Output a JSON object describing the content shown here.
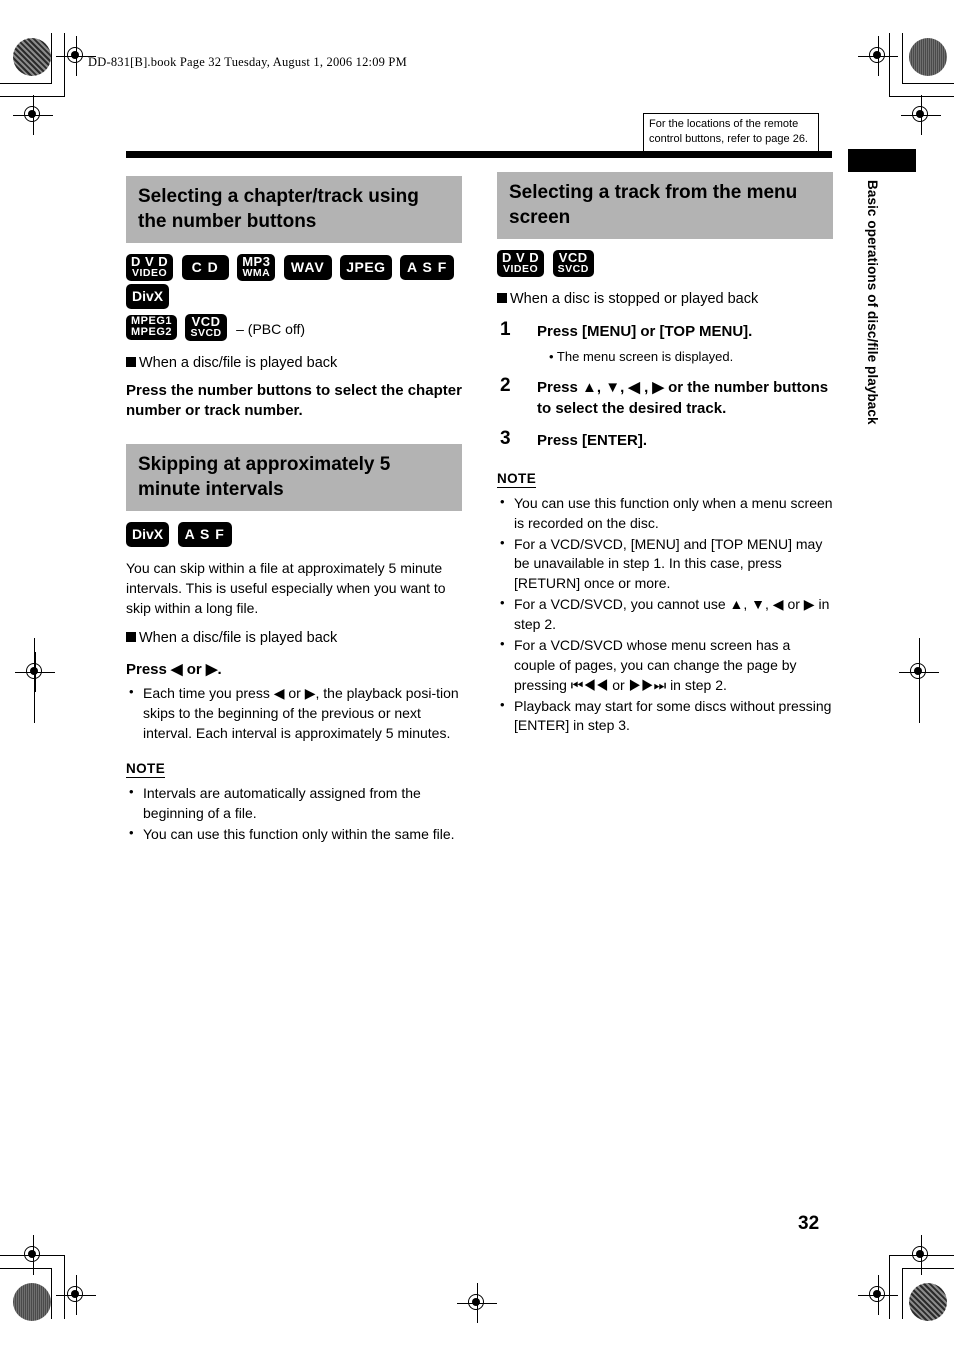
{
  "document": {
    "file_header": "DD-831[B].book  Page 32  Tuesday, August 1, 2006  12:09 PM",
    "page_number": "32",
    "side_tab_label": "Basic operations of disc/file playback",
    "reference_box": "For the locations of the remote control buttons, refer to page 26."
  },
  "colors": {
    "heading_bar": "#b3b3b3",
    "badge_background": "#000000",
    "rule": "#000000",
    "page_background": "#ffffff"
  },
  "left_column": {
    "section1": {
      "heading": "Selecting a chapter/track using the number buttons",
      "badges_row1": [
        {
          "type": "two-line",
          "line1": "D V D",
          "line2": "VIDEO"
        },
        {
          "type": "one-line",
          "text": "C D"
        },
        {
          "type": "two-line",
          "line1": "MP3",
          "line2": "WMA"
        },
        {
          "type": "one-line",
          "text": "WAV"
        },
        {
          "type": "one-line",
          "text": "JPEG"
        },
        {
          "type": "one-line",
          "text": "A S F"
        },
        {
          "type": "one-line",
          "text": "DivX"
        }
      ],
      "badges_row2": [
        {
          "type": "two-line",
          "line1": "MPEG1",
          "line2": "MPEG2"
        },
        {
          "type": "two-line",
          "line1": "VCD",
          "line2": "SVCD"
        }
      ],
      "badges_row2_suffix": "– (PBC off)",
      "condition": "When a disc/file is played back",
      "instruction": "Press the number buttons to select the chapter number or track number."
    },
    "section2": {
      "heading": "Skipping at approximately 5 minute intervals",
      "badges": [
        {
          "type": "one-line",
          "text": "DivX"
        },
        {
          "type": "one-line",
          "text": "A S F"
        }
      ],
      "body": "You can skip within a file at approximately 5 minute intervals. This is useful especially when you want to skip within a long file.",
      "condition": "When a disc/file is played back",
      "press_line": "Press ◀ or ▶.",
      "bullets": [
        "Each time you press ◀ or ▶, the playback posi-tion skips to the beginning of the previous or next interval. Each interval is approximately 5 minutes."
      ],
      "note_title": "NOTE",
      "note_bullets": [
        "Intervals are automatically assigned from the beginning of a file.",
        "You can use this function only within the same file."
      ]
    }
  },
  "right_column": {
    "section1": {
      "heading": "Selecting a track from the menu screen",
      "badges": [
        {
          "type": "two-line",
          "line1": "D V D",
          "line2": "VIDEO"
        },
        {
          "type": "two-line",
          "line1": "VCD",
          "line2": "SVCD"
        }
      ],
      "condition": "When a disc is stopped or played back",
      "steps": [
        {
          "number": "1",
          "text": "Press [MENU] or [TOP MENU].",
          "sub": "• The menu screen is displayed."
        },
        {
          "number": "2",
          "text": "Press ▲, ▼, ◀ , ▶ or the number buttons to select the desired track.",
          "sub": ""
        },
        {
          "number": "3",
          "text": "Press [ENTER].",
          "sub": ""
        }
      ],
      "note_title": "NOTE",
      "note_bullets": [
        "You can use this function only when a menu screen is recorded on the disc.",
        "For a VCD/SVCD, [MENU] and [TOP MENU] may be unavailable in step 1. In this case, press [RETURN] once or more.",
        "For a VCD/SVCD, you cannot use ▲, ▼, ◀ or ▶ in step 2.",
        "For a VCD/SVCD whose menu screen has a couple of pages, you can change the page by pressing ⏮◀◀ or ▶▶⏭ in step 2.",
        "Playback may start for some discs without pressing [ENTER] in step 3."
      ]
    }
  }
}
